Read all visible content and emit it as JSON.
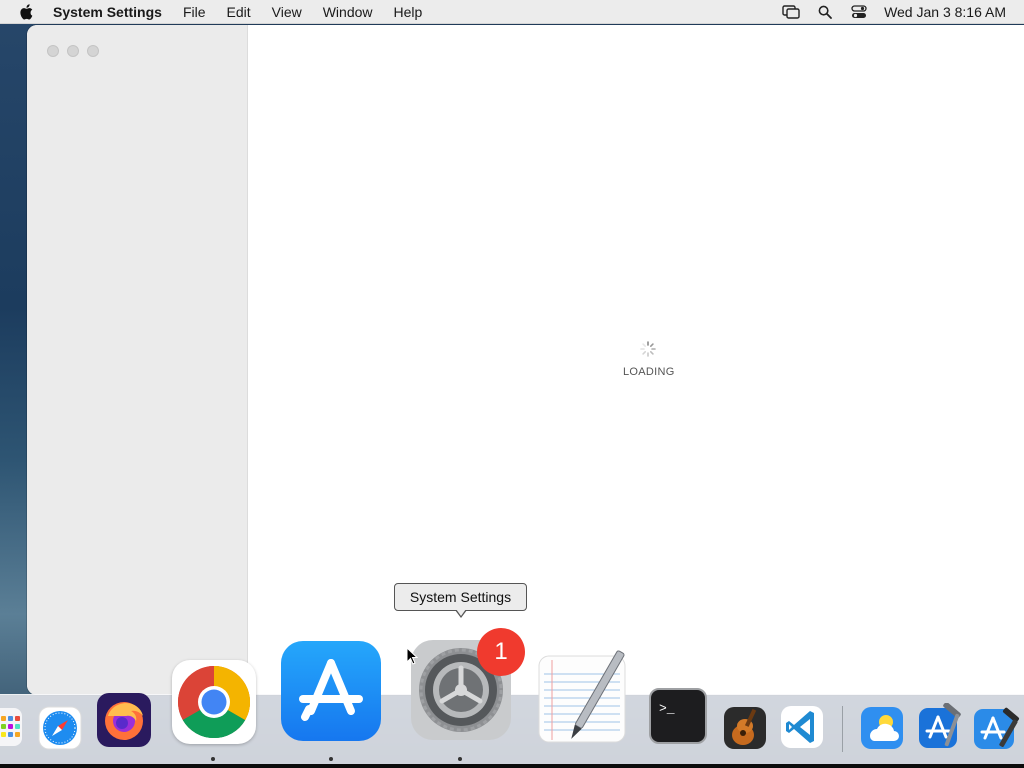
{
  "menubar": {
    "app_name": "System Settings",
    "menus": [
      "File",
      "Edit",
      "View",
      "Window",
      "Help"
    ],
    "clock": "Wed Jan 3  8:16 AM",
    "status_icons": [
      "screen-mirroring-icon",
      "spotlight-search-icon",
      "control-center-icon"
    ]
  },
  "window": {
    "loading_text": "LOADING"
  },
  "tooltip": {
    "label": "System Settings"
  },
  "dock": {
    "items": [
      {
        "name": "launchpad-icon",
        "running": false
      },
      {
        "name": "safari-icon",
        "running": false
      },
      {
        "name": "firefox-icon",
        "running": false
      },
      {
        "name": "chrome-icon",
        "running": true
      },
      {
        "name": "app-store-icon",
        "running": true
      },
      {
        "name": "system-settings-icon",
        "running": true,
        "badge": "1"
      },
      {
        "name": "textedit-icon",
        "running": false
      },
      {
        "name": "terminal-icon",
        "running": false
      },
      {
        "name": "garageband-icon",
        "running": false
      },
      {
        "name": "vscode-icon",
        "running": false
      },
      {
        "name": "weather-icon",
        "running": false
      },
      {
        "name": "xcode-icon",
        "running": false
      },
      {
        "name": "xcode-beta-icon",
        "running": false
      }
    ]
  },
  "colors": {
    "badge": "#f03a2e",
    "app_store_blue": "#1b8cf5",
    "menubar_bg": "#ececec"
  }
}
